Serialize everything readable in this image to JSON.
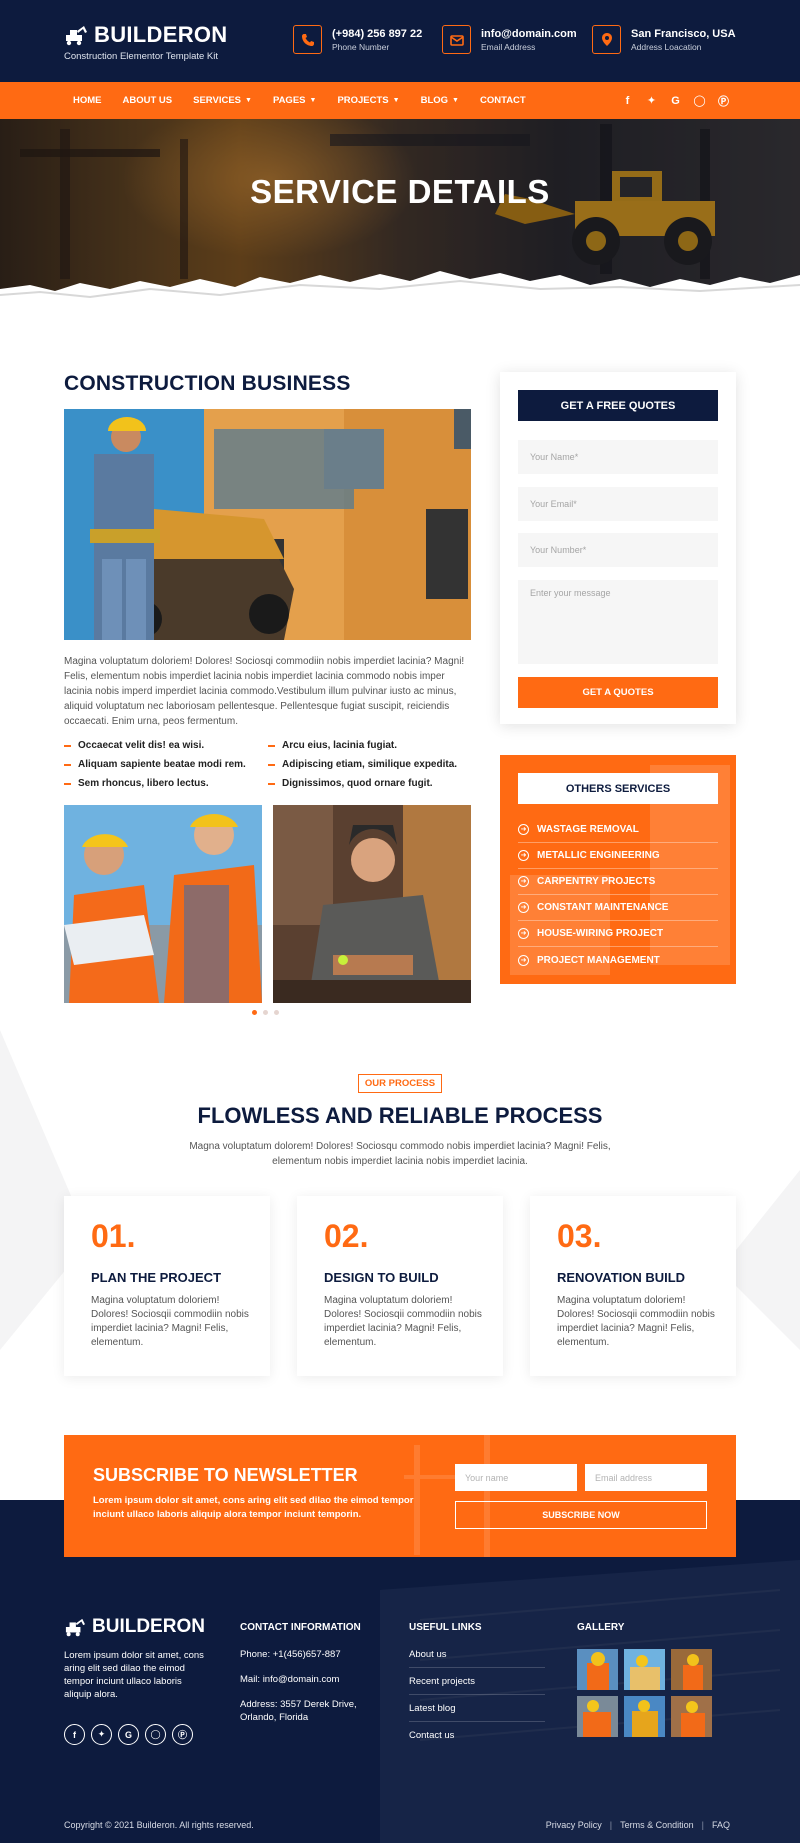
{
  "header": {
    "brand": "BUILDERON",
    "tagline": "Construction Elementor Template Kit",
    "contacts": [
      {
        "icon": "phone-icon",
        "title": "(+984) 256 897 22",
        "subtitle": "Phone Number"
      },
      {
        "icon": "email-icon",
        "title": "info@domain.com",
        "subtitle": "Email Address"
      },
      {
        "icon": "location-icon",
        "title": "San Francisco, USA",
        "subtitle": "Address Loacation"
      }
    ]
  },
  "nav": {
    "items": [
      "HOME",
      "ABOUT US",
      "SERVICES",
      "PAGES",
      "PROJECTS",
      "BLOG",
      "CONTACT"
    ],
    "social": [
      "facebook-icon",
      "twitter-icon",
      "google-icon",
      "instagram-icon",
      "pinterest-icon"
    ]
  },
  "hero": {
    "title": "SERVICE DETAILS"
  },
  "main": {
    "title": "CONSTRUCTION BUSINESS",
    "paragraph": "Magina voluptatum doloriem! Dolores! Sociosqi commodiin nobis imperdiet lacinia? Magni! Felis, elementum nobis imperdiet lacinia nobis imperdiet lacinia commodo nobis imper lacinia nobis imperd imperdiet lacinia commodo.Vestibulum illum pulvinar iusto ac minus, aliquid voluptatum nec laboriosam pellentesque. Pellentesque fugiat suscipit, reiciendis occaecati. Enim urna, peos fermentum.",
    "bullets_left": [
      "Occaecat velit dis! ea wisi.",
      "Aliquam sapiente beatae modi rem.",
      "Sem rhoncus, libero lectus."
    ],
    "bullets_right": [
      "Arcu eius, lacinia fugiat.",
      "Adipiscing etiam, similique expedita.",
      "Dignissimos, quod ornare fugit."
    ]
  },
  "quote": {
    "title": "GET A FREE QUOTES",
    "name_placeholder": "Your Name*",
    "email_placeholder": "Your Email*",
    "number_placeholder": "Your Number*",
    "message_placeholder": "Enter your message",
    "button": "GET A QUOTES"
  },
  "others": {
    "title": "OTHERS SERVICES",
    "items": [
      "WASTAGE REMOVAL",
      "METALLIC ENGINEERING",
      "CARPENTRY PROJECTS",
      "CONSTANT MAINTENANCE",
      "HOUSE-WIRING PROJECT",
      "PROJECT MANAGEMENT"
    ]
  },
  "process": {
    "badge": "OUR PROCESS",
    "title": "FLOWLESS AND RELIABLE PROCESS",
    "subtitle": "Magna voluptatum dolorem! Dolores! Sociosqu commodo nobis imperdiet lacinia? Magni! Felis, elementum nobis imperdiet lacinia nobis imperdiet lacinia.",
    "cards": [
      {
        "num": "01.",
        "title": "PLAN THE PROJECT",
        "text": "Magina voluptatum doloriem! Dolores! Sociosqii commodiin nobis imperdiet lacinia? Magni! Felis, elementum."
      },
      {
        "num": "02.",
        "title": "DESIGN TO BUILD",
        "text": "Magina voluptatum doloriem! Dolores! Sociosqii commodiin nobis imperdiet lacinia? Magni! Felis, elementum."
      },
      {
        "num": "03.",
        "title": "RENOVATION BUILD",
        "text": "Magina voluptatum doloriem! Dolores! Sociosqii commodiin nobis imperdiet lacinia? Magni! Felis, elementum."
      }
    ]
  },
  "newsletter": {
    "title": "SUBSCRIBE TO NEWSLETTER",
    "text": "Lorem ipsum dolor sit amet, cons aring elit sed dilao the eimod tempor inciunt ullaco laboris aliquip alora tempor inciunt temporin.",
    "name_placeholder": "Your name",
    "email_placeholder": "Email address",
    "button": "SUBSCRIBE NOW"
  },
  "footer": {
    "brand": "BUILDERON",
    "about": "Lorem ipsum dolor sit amet, cons aring elit sed dilao the eimod tempor inciunt ullaco laboris aliquip alora.",
    "contact_title": "CONTACT INFORMATION",
    "phone": "Phone: +1(456)657-887",
    "mail": "Mail: info@domain.com",
    "address": "Address: 3557 Derek Drive, Orlando, Florida",
    "links_title": "USEFUL LINKS",
    "links": [
      "About us",
      "Recent projects",
      "Latest blog",
      "Contact us"
    ],
    "gallery_title": "GALLERY",
    "copyright": "Copyright © 2021 Builderon. All rights reserved.",
    "bottom_links": [
      "Privacy Policy",
      "Terms & Condition",
      "FAQ"
    ]
  },
  "colors": {
    "accent": "#ff6a13",
    "navy": "#0d1b3e"
  }
}
